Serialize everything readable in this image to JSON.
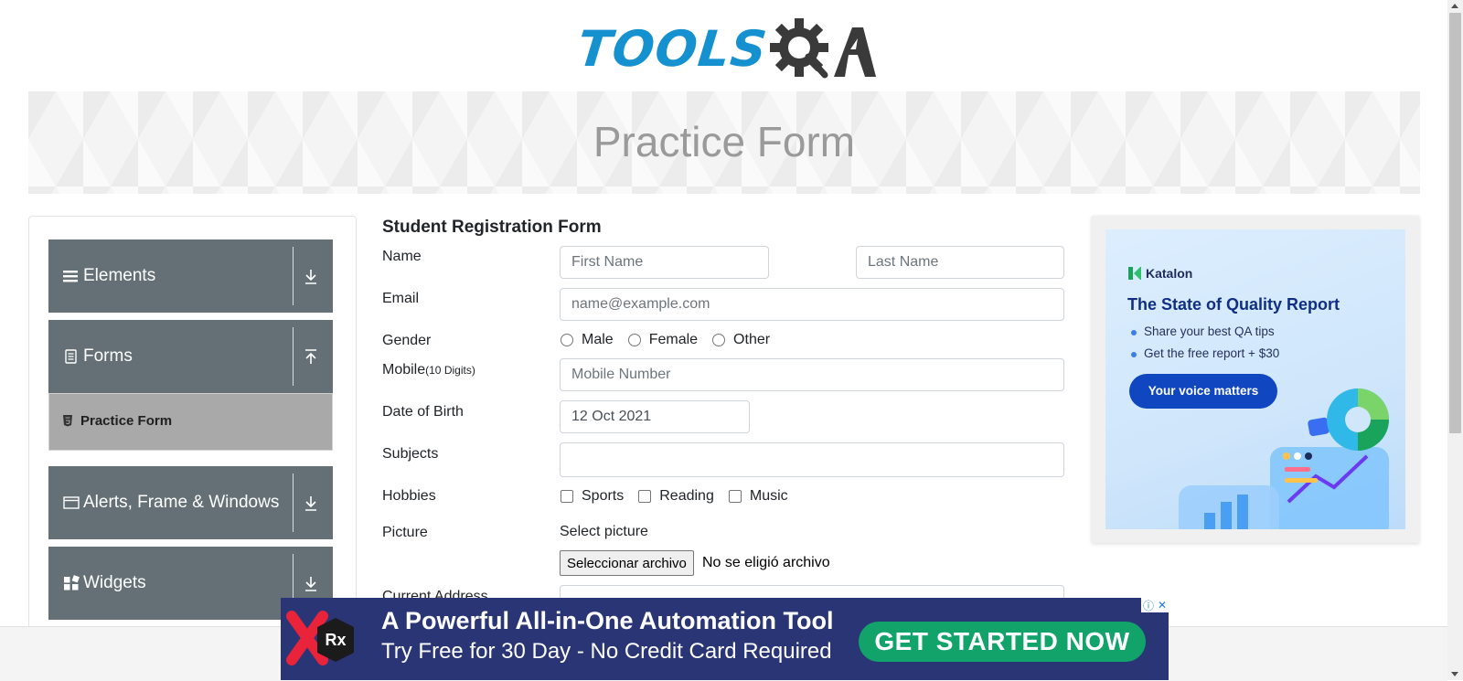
{
  "header": {
    "logo_text": "TOOLS",
    "logo_suffix": "QA",
    "banner_title": "Practice Form"
  },
  "sidebar": {
    "groups": [
      {
        "label": "Elements",
        "icon": "menu-lines-icon",
        "arrow": "download-arrow-icon"
      },
      {
        "label": "Forms",
        "icon": "document-icon",
        "arrow": "upload-arrow-icon"
      },
      {
        "label": "Alerts, Frame & Windows",
        "icon": "window-icon",
        "arrow": "download-arrow-icon"
      },
      {
        "label": "Widgets",
        "icon": "widgets-icon",
        "arrow": "download-arrow-icon"
      }
    ],
    "active_item": {
      "label": "Practice Form",
      "icon": "html5-icon"
    }
  },
  "form": {
    "title": "Student Registration Form",
    "name_label": "Name",
    "first_name_placeholder": "First Name",
    "last_name_placeholder": "Last Name",
    "email_label": "Email",
    "email_placeholder": "name@example.com",
    "gender_label": "Gender",
    "gender_options": [
      "Male",
      "Female",
      "Other"
    ],
    "mobile_label": "Mobile",
    "mobile_hint": "(10 Digits)",
    "mobile_placeholder": "Mobile Number",
    "dob_label": "Date of Birth",
    "dob_value": "12 Oct 2021",
    "subjects_label": "Subjects",
    "hobbies_label": "Hobbies",
    "hobbies_options": [
      "Sports",
      "Reading",
      "Music"
    ],
    "picture_label": "Picture",
    "select_picture": "Select picture",
    "file_button": "Seleccionar archivo",
    "file_status": "No se eligió archivo",
    "address_label": "Current Address"
  },
  "side_ad": {
    "brand": "Katalon",
    "headline": "The State of Quality Report",
    "bullet1": "Share your best QA tips",
    "bullet2": "Get the free report + $30",
    "cta": "Your voice matters"
  },
  "bottom_ad": {
    "logo_text": "Rx",
    "line1": "A Powerful All-in-One Automation Tool",
    "line2": "Try Free for 30 Day - No Credit Card Required",
    "cta": "GET STARTED NOW"
  },
  "colors": {
    "sidebar_group": "#647075",
    "sidebar_active": "#a9a9a9",
    "brand_blue": "#1591cf",
    "bottom_ad_bg": "#2a3576",
    "bottom_ad_cta": "#12a36b"
  }
}
